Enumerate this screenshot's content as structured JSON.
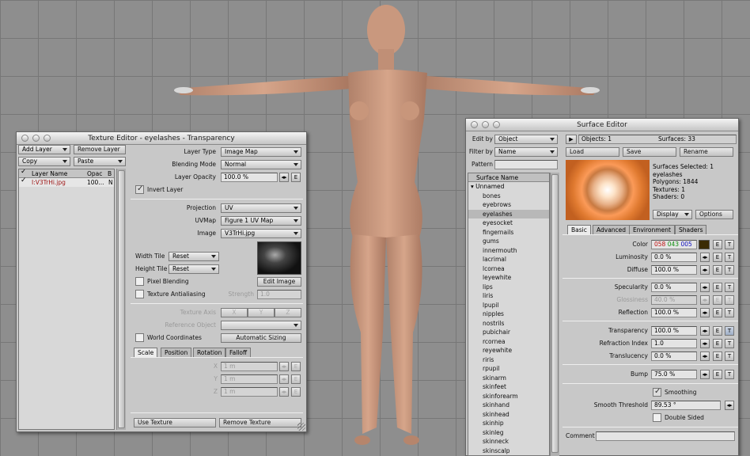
{
  "texture_editor": {
    "title": "Texture Editor - eyelashes - Transparency",
    "add_layer": "Add Layer",
    "remove_layer": "Remove Layer",
    "copy": "Copy",
    "paste": "Paste",
    "col_layer_name": "Layer Name",
    "col_opac": "Opac",
    "col_b": "B",
    "layer_row": {
      "name": "I:V3TrHi.jpg",
      "opac": "100...",
      "b": "N"
    },
    "layer_type_label": "Layer Type",
    "layer_type": "Image Map",
    "blending_mode_label": "Blending Mode",
    "blending_mode": "Normal",
    "layer_opacity_label": "Layer Opacity",
    "layer_opacity": "100.0 %",
    "invert_layer": "Invert Layer",
    "projection_label": "Projection",
    "projection": "UV",
    "uvmap_label": "UVMap",
    "uvmap": "Figure 1 UV Map",
    "image_label": "Image",
    "image": "V3TrHi.jpg",
    "width_tile_label": "Width Tile",
    "width_tile": "Reset",
    "height_tile_label": "Height Tile",
    "height_tile": "Reset",
    "edit_image": "Edit Image",
    "pixel_blending": "Pixel Blending",
    "texture_antialiasing": "Texture Antialiasing",
    "strength_label": "Strength",
    "strength": "1.0",
    "texture_axis_label": "Texture Axis",
    "axis_x": "X",
    "axis_y": "Y",
    "axis_z": "Z",
    "reference_object_label": "Reference Object",
    "world_coordinates": "World Coordinates",
    "automatic_sizing": "Automatic Sizing",
    "tabs": [
      "Scale",
      "Position",
      "Rotation",
      "Falloff"
    ],
    "x_label": "X",
    "y_label": "Y",
    "z_label": "Z",
    "x_val": "1 m",
    "y_val": "1 m",
    "z_val": "1 m",
    "e": "E",
    "use_texture": "Use Texture",
    "remove_texture": "Remove Texture"
  },
  "surface_editor": {
    "title": "Surface Editor",
    "edit_by_label": "Edit by",
    "edit_by": "Object",
    "filter_by_label": "Filter by",
    "filter_by": "Name",
    "pattern_label": "Pattern",
    "objects": "Objects: 1",
    "surfaces": "Surfaces: 33",
    "load": "Load",
    "save": "Save",
    "rename": "Rename",
    "surface_name_header": "Surface Name",
    "group": "Unnamed",
    "surface_list": [
      "bones",
      "eyebrows",
      "eyelashes",
      "eyesocket",
      "fingernails",
      "gums",
      "innermouth",
      "lacrimal",
      "lcornea",
      "leyewhite",
      "lips",
      "liris",
      "lpupil",
      "nipples",
      "nostrils",
      "pubichair",
      "rcornea",
      "reyewhite",
      "riris",
      "rpupil",
      "skinarm",
      "skinfeet",
      "skinforearm",
      "skinhand",
      "skinhead",
      "skinhip",
      "skinleg",
      "skinneck",
      "skinscalp"
    ],
    "selected_surface": "eyelashes",
    "info": [
      "Surfaces Selected: 1",
      "eyelashes",
      "Polygons: 1844",
      "Textures: 1",
      "Shaders: 0"
    ],
    "display": "Display",
    "options": "Options",
    "tabs": [
      "Basic",
      "Advanced",
      "Environment",
      "Shaders"
    ],
    "color_label": "Color",
    "color_r": "058",
    "color_g": "043",
    "color_b": "005",
    "luminosity_label": "Luminosity",
    "luminosity": "0.0 %",
    "diffuse_label": "Diffuse",
    "diffuse": "100.0 %",
    "specularity_label": "Specularity",
    "specularity": "0.0 %",
    "glossiness_label": "Glossiness",
    "glossiness": "40.0 %",
    "reflection_label": "Reflection",
    "reflection": "100.0 %",
    "transparency_label": "Transparency",
    "transparency": "100.0 %",
    "refraction_label": "Refraction Index",
    "refraction": "1.0",
    "translucency_label": "Translucency",
    "translucency": "0.0 %",
    "bump_label": "Bump",
    "bump": "75.0 %",
    "smoothing": "Smoothing",
    "smooth_threshold_label": "Smooth Threshold",
    "smooth_threshold": "89.53 °",
    "double_sided": "Double Sided",
    "comment_label": "Comment",
    "e": "E",
    "t": "T"
  }
}
